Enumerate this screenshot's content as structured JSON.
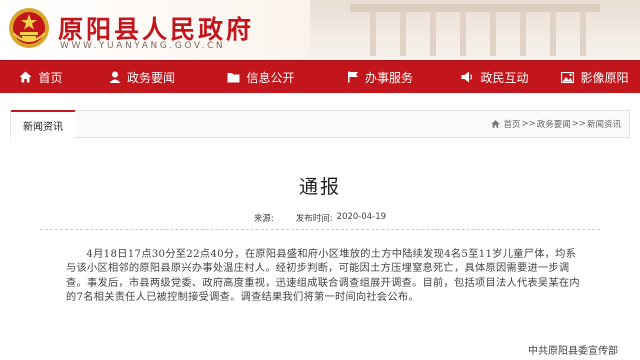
{
  "header": {
    "site_title": "原阳县人民政府",
    "site_url": "WWW.YUANYANG.GOV.CN"
  },
  "colors": {
    "brand_red": "#c3161c",
    "header_bg": "#f7efe8",
    "text": "#444444"
  },
  "nav": {
    "items": [
      {
        "label": "首页",
        "icon": "home-icon"
      },
      {
        "label": "政务要闻",
        "icon": "person-icon"
      },
      {
        "label": "信息公开",
        "icon": "folder-icon"
      },
      {
        "label": "办事服务",
        "icon": "flag-icon"
      },
      {
        "label": "政民互动",
        "icon": "speaker-icon"
      },
      {
        "label": "影像原阳",
        "icon": "image-icon"
      }
    ]
  },
  "section": {
    "tab_label": "新闻资讯",
    "breadcrumb": [
      "首页",
      "政务要闻",
      "新闻资讯"
    ],
    "breadcrumb_sep": ">>"
  },
  "article": {
    "title": "通报",
    "source_label": "来源:",
    "source_value": "",
    "date_label": "发布时间:",
    "date_value": "2020-04-19",
    "body": "4月18日17点30分至22点40分，在原阳县盛和府小区堆放的土方中陆续发现4名5至11岁儿童尸体，均系与该小区相邻的原阳县原兴办事处温庄村人。经初步判断，可能因土方压埋窒息死亡，具体原因需要进一步调查。事发后，市县两级党委、政府高度重视，迅速组成联合调查组展开调查。目前，包括项目法人代表吴某在内的7名相关责任人已被控制接受调查。调查结果我们将第一时间向社会公布。",
    "signature": "中共原阳县委宣传部"
  }
}
